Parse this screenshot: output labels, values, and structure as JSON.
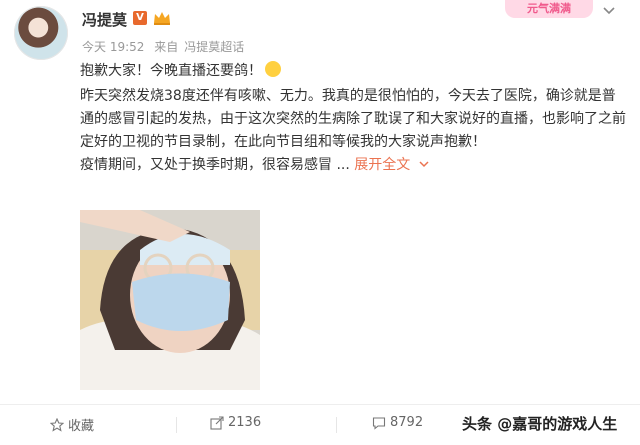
{
  "post": {
    "author_name": "冯提莫",
    "vip_label": "V",
    "top_badge": "元气满满",
    "time": "今天 19:52",
    "source_prefix": "来自",
    "source": "冯提莫超话",
    "line1": "抱歉大家！今晚直播还要鸽！",
    "para1": "昨天突然发烧38度还伴有咳嗽、无力。我真的是很怕怕的，今天去了医院，确诊就是普通的感冒引起的发热，由于这次突然的生病除了耽误了和大家说好的直播，也影响了之前定好的卫视的节目录制，在此向节目组和等候我的大家说声抱歉！",
    "para2": "疫情期间，又处于换季时期，很容易感冒",
    "ellipsis": " ... ",
    "expand_label": "展开全文",
    "expand_icon": "chevron-down-icon"
  },
  "actions": {
    "favorite_label": "收藏",
    "repost_count": "2136",
    "comment_count": "8792"
  },
  "watermark": "头条 @嘉哥的游戏人生"
}
